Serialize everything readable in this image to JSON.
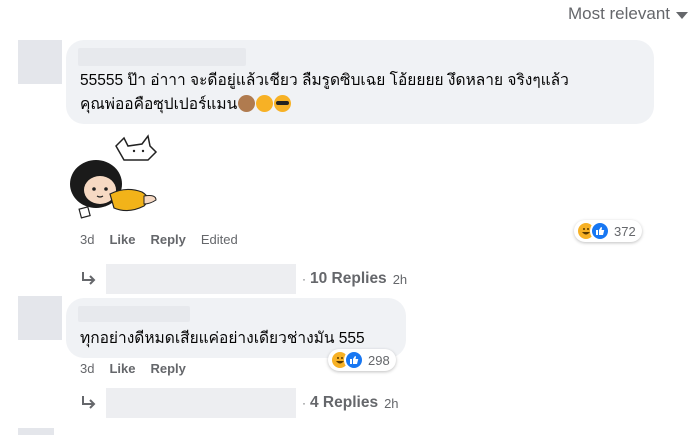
{
  "sort": {
    "label": "Most relevant",
    "icon": "chevron-down-icon"
  },
  "comments": [
    {
      "text_line1": "55555 ป๊า อ่าาา จะดีอยู่แล้วเชียว ลืมรูดซิบเฉย โอ้ยยยย งึดหลาย จริงๆแล้ว",
      "text_line2": "คุณพ่ออคือซุปเปอร์แมน",
      "emojis": [
        "see-no-evil-monkey-emoji",
        "rolling-laughing-emoji",
        "sunglasses-emoji"
      ],
      "sticker": "cartoon-kid-sticker",
      "time": "3d",
      "like": "Like",
      "reply": "Reply",
      "edited": "Edited",
      "reaction_count": "372",
      "replies_label": "10 Replies",
      "replies_time": "2h"
    },
    {
      "text_line1": "ทุกอย่างดีหมดเสียแค่อย่างเดียวช่างมัน 555",
      "time": "3d",
      "like": "Like",
      "reply": "Reply",
      "reaction_count": "298",
      "replies_label": "4 Replies",
      "replies_time": "2h"
    }
  ],
  "colors": {
    "like_blue": "#1877f2",
    "haha_yellow": "#f7b125",
    "muted": "#65676b",
    "bubble": "#f0f2f5"
  }
}
